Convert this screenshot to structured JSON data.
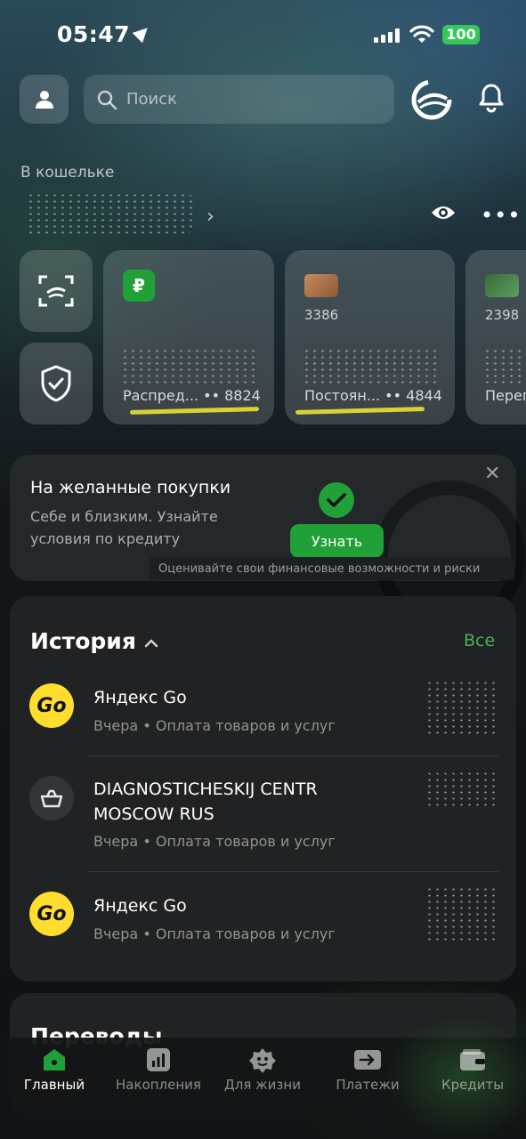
{
  "status_bar": {
    "time": "05:47",
    "battery": "100"
  },
  "search": {
    "placeholder": "Поиск"
  },
  "wallet": {
    "label": "В кошельке"
  },
  "cards": [
    {
      "number": "",
      "name": "Распред...",
      "last4": "•• 8824"
    },
    {
      "number": "3386",
      "name": "Постоян...",
      "last4": "•• 4844"
    },
    {
      "number": "2398",
      "name": "Перег",
      "last4": ""
    }
  ],
  "promo": {
    "title": "На желанные покупки",
    "subtitle": "Себе и близким. Узнайте условия по кредиту",
    "button": "Узнать",
    "note": "Оценивайте свои финансовые возможности и риски"
  },
  "history": {
    "title": "История",
    "all": "Все",
    "items": [
      {
        "title": "Яндекс Go",
        "subtitle": "Вчера • Оплата товаров и услуг",
        "icon": "Go"
      },
      {
        "title": "DIAGNOSTICHESKIJ CENTR MOSCOW RUS",
        "subtitle": "Вчера • Оплата товаров и услуг"
      },
      {
        "title": "Яндекс Go",
        "subtitle": "Вчера • Оплата товаров и услуг",
        "icon": "Go"
      }
    ]
  },
  "transfers": {
    "title": "Переводы"
  },
  "tabs": [
    {
      "label": "Главный"
    },
    {
      "label": "Накопления"
    },
    {
      "label": "Для жизни"
    },
    {
      "label": "Платежи"
    },
    {
      "label": "Кредиты"
    }
  ],
  "colors": {
    "accent": "#21a038",
    "link": "#4cb05a",
    "highlight": "#d7d335"
  }
}
